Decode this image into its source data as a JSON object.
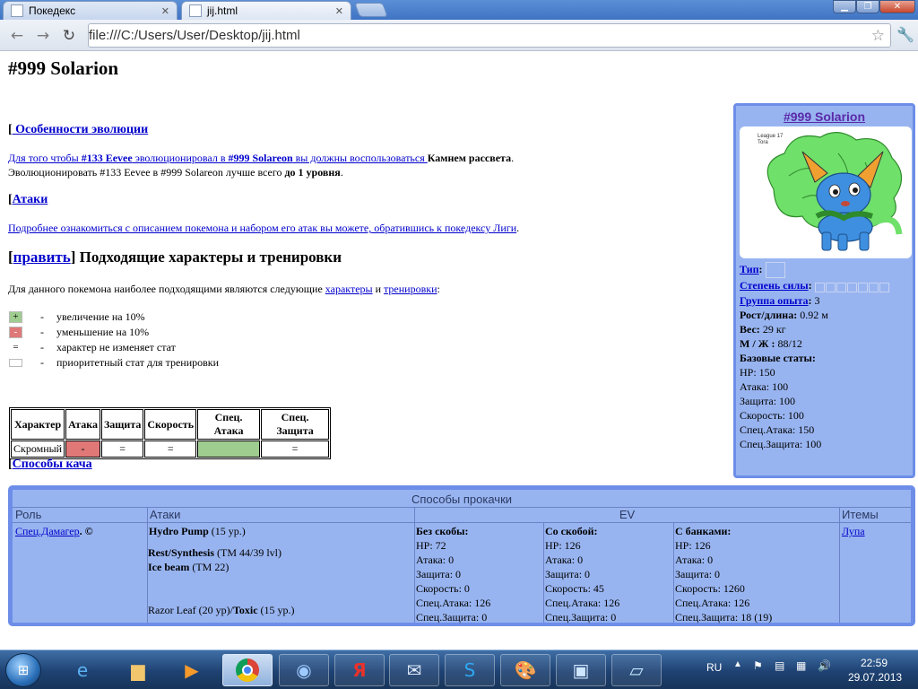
{
  "browser": {
    "tabs": [
      {
        "label": "Покедекс"
      },
      {
        "label": "jij.html"
      }
    ],
    "url": "file:///C:/Users/User/Desktop/jij.html"
  },
  "page": {
    "title": "#999 Solarion",
    "evo": {
      "bracket": "[",
      "heading": " Особенности эволюции",
      "l1_pre": "Для того чтобы ",
      "l1_eevee": "#133 Eevee",
      "l1_mid": " эволюционировал в ",
      "l1_solareon": "#999 Solareon",
      "l1_tail": " вы должны воспользоваться ",
      "l1_item": "Камнем рассвета",
      "l1_end": ".",
      "l2_pre": "Эволюционировать #133 Eevee в #999 Solareon лучше всего ",
      "l2_bold": "до 1 уровня",
      "l2_end": "."
    },
    "attacks": {
      "bracket": "[",
      "heading": "Атаки",
      "link": "Подробнее ознакомиться с описанием покемона и набором его атак вы можете, обратившись к покедексу Лиги",
      "end": "."
    },
    "natures": {
      "bracket_open": "[",
      "edit": "править",
      "bracket_close": "]",
      "heading": " Подходящие характеры и тренировки",
      "intro_pre": "Для данного покемона наиболее подходящими являются следующие ",
      "intro_link1": "характеры",
      "intro_and": " и ",
      "intro_link2": "тренировки",
      "intro_end": ":"
    },
    "legend": [
      {
        "symbol": "+",
        "dash": "-",
        "text": "увеличение на 10%",
        "color": "#9fcc8f"
      },
      {
        "symbol": "-",
        "dash": "-",
        "text": "уменьшение на 10%",
        "color": "#e07878"
      },
      {
        "symbol": "=",
        "dash": "-",
        "text": "характер не изменяет стат",
        "color": "#ffffff"
      },
      {
        "symbol": "",
        "dash": "-",
        "text": "приоритетный стат для тренировки",
        "color": "#ffffff"
      }
    ],
    "stat_table": {
      "headers": [
        "Характер",
        "Атака",
        "Защита",
        "Скорость",
        "Спец. Атака",
        "Спец. Защита"
      ],
      "row": [
        "Скромный",
        "-",
        "=",
        "=",
        "+++",
        "="
      ]
    },
    "leveling": {
      "bracket": "[",
      "heading": "Способы кача"
    }
  },
  "infobox": {
    "title": "#999 Solarion",
    "image_caption_1": "League 17",
    "image_caption_2": "Tora",
    "type_label": "Тип",
    "power_label": "Степень силы",
    "exp_label": "Группа опыта",
    "exp_value": " 3",
    "height_label": "Рост/длина:",
    "height_value": " 0.92 м",
    "weight_label": "Вес:",
    "weight_value": " 29 кг",
    "gender_label": "М / Ж :",
    "gender_value": " 88/12",
    "base_label": "Базовые статы:",
    "base_stats": [
      "HP: 150",
      "Атака: 100",
      "Защита: 100",
      "Скорость: 100",
      "Спец.Атака: 150",
      "Спец.Защита: 100"
    ]
  },
  "training": {
    "caption": "Способы прокачки",
    "headers": {
      "role": "Роль",
      "attacks": "Атаки",
      "ev": "EV",
      "items": "Итемы"
    },
    "role_link": "Спец.Дамагер",
    "role_suffix": ". ©",
    "attacks": {
      "a1_bold": "Hydro Pump",
      "a1_rest": " (15 ур.)",
      "a2_bold": "Rest/Synthesis",
      "a2_rest": " (TM 44/39 lvl)",
      "a3_bold": "Ice beam",
      "a3_rest": " (TM 22)",
      "a4_pre": "Razor Leaf (20 ур)/",
      "a4_bold": "Toxic",
      "a4_rest": " (15 ур.)"
    },
    "ev_columns": [
      {
        "title": "Без скобы:",
        "lines": [
          "HP: 72",
          "Атака: 0",
          "Защита: 0",
          "Скорость: 0",
          "Спец.Атака: 126",
          "Спец.Защита: 0"
        ]
      },
      {
        "title": "Со скобой:",
        "lines": [
          "HP: 126",
          "Атака: 0",
          "Защита: 0",
          "Скорость: 45",
          "Спец.Атака: 126",
          "Спец.Защита: 0"
        ]
      },
      {
        "title": "С банками:",
        "lines": [
          "HP: 126",
          "Атака: 0",
          "Защита: 0",
          "Скорость: 1260",
          "Спец.Атака: 126",
          "Спец.Защита: 18 (19)"
        ]
      }
    ],
    "item_link": "Лупа"
  },
  "taskbar": {
    "lang": "RU",
    "time": "22:59",
    "date": "29.07.2013"
  }
}
